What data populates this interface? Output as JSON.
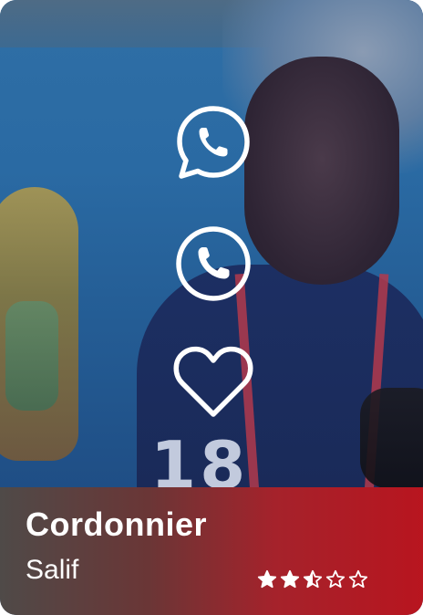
{
  "card": {
    "title": "Cordonnier",
    "subtitle": "Salif",
    "rating": {
      "value": 2.5,
      "max": 5
    },
    "photo": {
      "jersey_number": "18"
    }
  },
  "actions": [
    {
      "name": "whatsapp-icon"
    },
    {
      "name": "phone-icon"
    },
    {
      "name": "heart-icon"
    }
  ],
  "colors": {
    "band_start": "#4f4a48",
    "band_end": "#b8151f",
    "icon": "#ffffff",
    "star": "#ffffff"
  }
}
